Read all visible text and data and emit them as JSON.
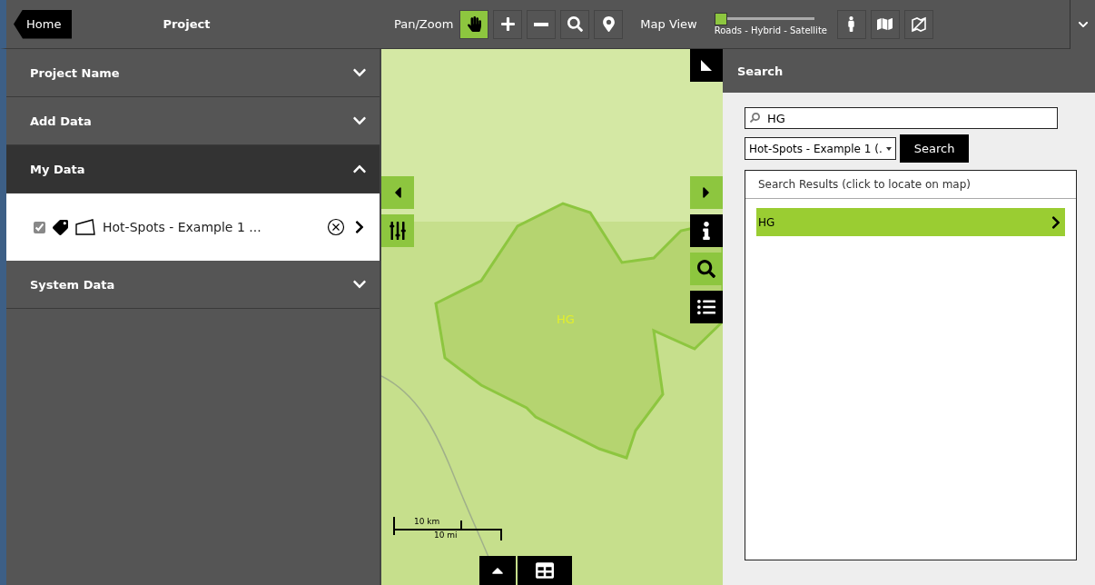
{
  "sidebar": {
    "home": "Home",
    "title": "Project",
    "sections": [
      {
        "title": "Project Name",
        "expanded": false
      },
      {
        "title": "Add Data",
        "expanded": false
      },
      {
        "title": "My Data",
        "expanded": true,
        "layers": [
          {
            "name": "Hot-Spots - Example 1 ...",
            "checked": true
          }
        ]
      },
      {
        "title": "System Data",
        "expanded": false
      }
    ]
  },
  "toolbar": {
    "pan_zoom_label": "Pan/Zoom",
    "tools": [
      {
        "kind": "hand",
        "selected": true
      },
      {
        "kind": "plus",
        "selected": false
      },
      {
        "kind": "minus",
        "selected": false
      },
      {
        "kind": "search",
        "selected": false
      },
      {
        "kind": "pin",
        "selected": false
      }
    ],
    "map_view_label": "Map View",
    "map_view_slider": {
      "level": 0,
      "caption": "Roads - Hybrid - Satellite"
    },
    "layer_buttons": [
      {
        "kind": "person"
      },
      {
        "kind": "map"
      },
      {
        "kind": "no-map"
      }
    ]
  },
  "map": {
    "region_label": "HG",
    "scale": {
      "km": "10 km",
      "mi": "10 mi"
    }
  },
  "search_panel": {
    "title": "Search",
    "query": "HG",
    "layer_select": "Hot-Spots - Example 1 (.",
    "button": "Search",
    "results_title": "Search Results (click to locate on map)",
    "results": [
      {
        "label": "HG",
        "selected": true
      }
    ]
  }
}
